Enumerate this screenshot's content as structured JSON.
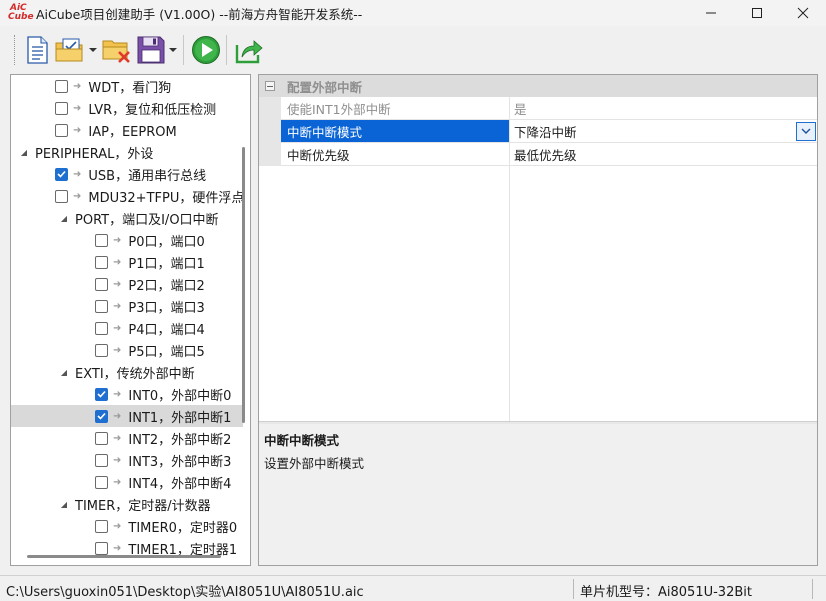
{
  "window": {
    "logo_top": "AiC",
    "logo_bottom": "Cube",
    "title": "AiCube项目创建助手 (V1.00O) --前海方舟智能开发系统--"
  },
  "toolbar": {
    "buttons": [
      "new-file-icon",
      "open-project-icon",
      "close-project-icon",
      "save-icon",
      "run-icon",
      "export-icon"
    ]
  },
  "tree": {
    "items": [
      {
        "label": "WDT，看门狗",
        "checked": false,
        "level": 2
      },
      {
        "label": "LVR，复位和低压检测",
        "checked": false,
        "level": 2
      },
      {
        "label": "IAP，EEPROM",
        "checked": false,
        "level": 2
      },
      {
        "label": "PERIPHERAL，外设",
        "level": 0,
        "group": true
      },
      {
        "label": "USB，通用串行总线",
        "checked": true,
        "level": 2
      },
      {
        "label": "MDU32+TFPU，硬件浮点",
        "checked": false,
        "level": 2
      },
      {
        "label": "PORT，端口及I/O口中断",
        "level": 1,
        "group": true
      },
      {
        "label": "P0口，端口0",
        "checked": false,
        "level": 3
      },
      {
        "label": "P1口，端口1",
        "checked": false,
        "level": 3
      },
      {
        "label": "P2口，端口2",
        "checked": false,
        "level": 3
      },
      {
        "label": "P3口，端口3",
        "checked": false,
        "level": 3
      },
      {
        "label": "P4口，端口4",
        "checked": false,
        "level": 3
      },
      {
        "label": "P5口，端口5",
        "checked": false,
        "level": 3
      },
      {
        "label": "EXTI，传统外部中断",
        "level": 1,
        "group": true
      },
      {
        "label": "INT0，外部中断0",
        "checked": true,
        "level": 3
      },
      {
        "label": "INT1，外部中断1",
        "checked": true,
        "level": 3,
        "selected": true
      },
      {
        "label": "INT2，外部中断2",
        "checked": false,
        "level": 3
      },
      {
        "label": "INT3，外部中断3",
        "checked": false,
        "level": 3
      },
      {
        "label": "INT4，外部中断4",
        "checked": false,
        "level": 3
      },
      {
        "label": "TIMER，定时器/计数器",
        "level": 1,
        "group": true
      },
      {
        "label": "TIMER0，定时器0",
        "checked": false,
        "level": 3
      },
      {
        "label": "TIMER1，定时器1",
        "checked": false,
        "level": 3
      }
    ]
  },
  "properties": {
    "category": "配置外部中断",
    "rows": [
      {
        "name": "使能INT1外部中断",
        "value": "是",
        "disabled": true
      },
      {
        "name": "中断中断模式",
        "value": "下降沿中断",
        "active": true
      },
      {
        "name": "中断优先级",
        "value": "最低优先级"
      }
    ],
    "description_title": "中断中断模式",
    "description_text": "设置外部中断模式"
  },
  "status": {
    "path": "C:\\Users\\guoxin051\\Desktop\\实验\\AI8051U\\AI8051U.aic",
    "chip": "单片机型号：Ai8051U-32Bit"
  },
  "colors": {
    "accent": "#0a64d6",
    "checkbox": "#1f6fd1",
    "logo": "#d42a2a",
    "run_green": "#2e9e3a"
  }
}
